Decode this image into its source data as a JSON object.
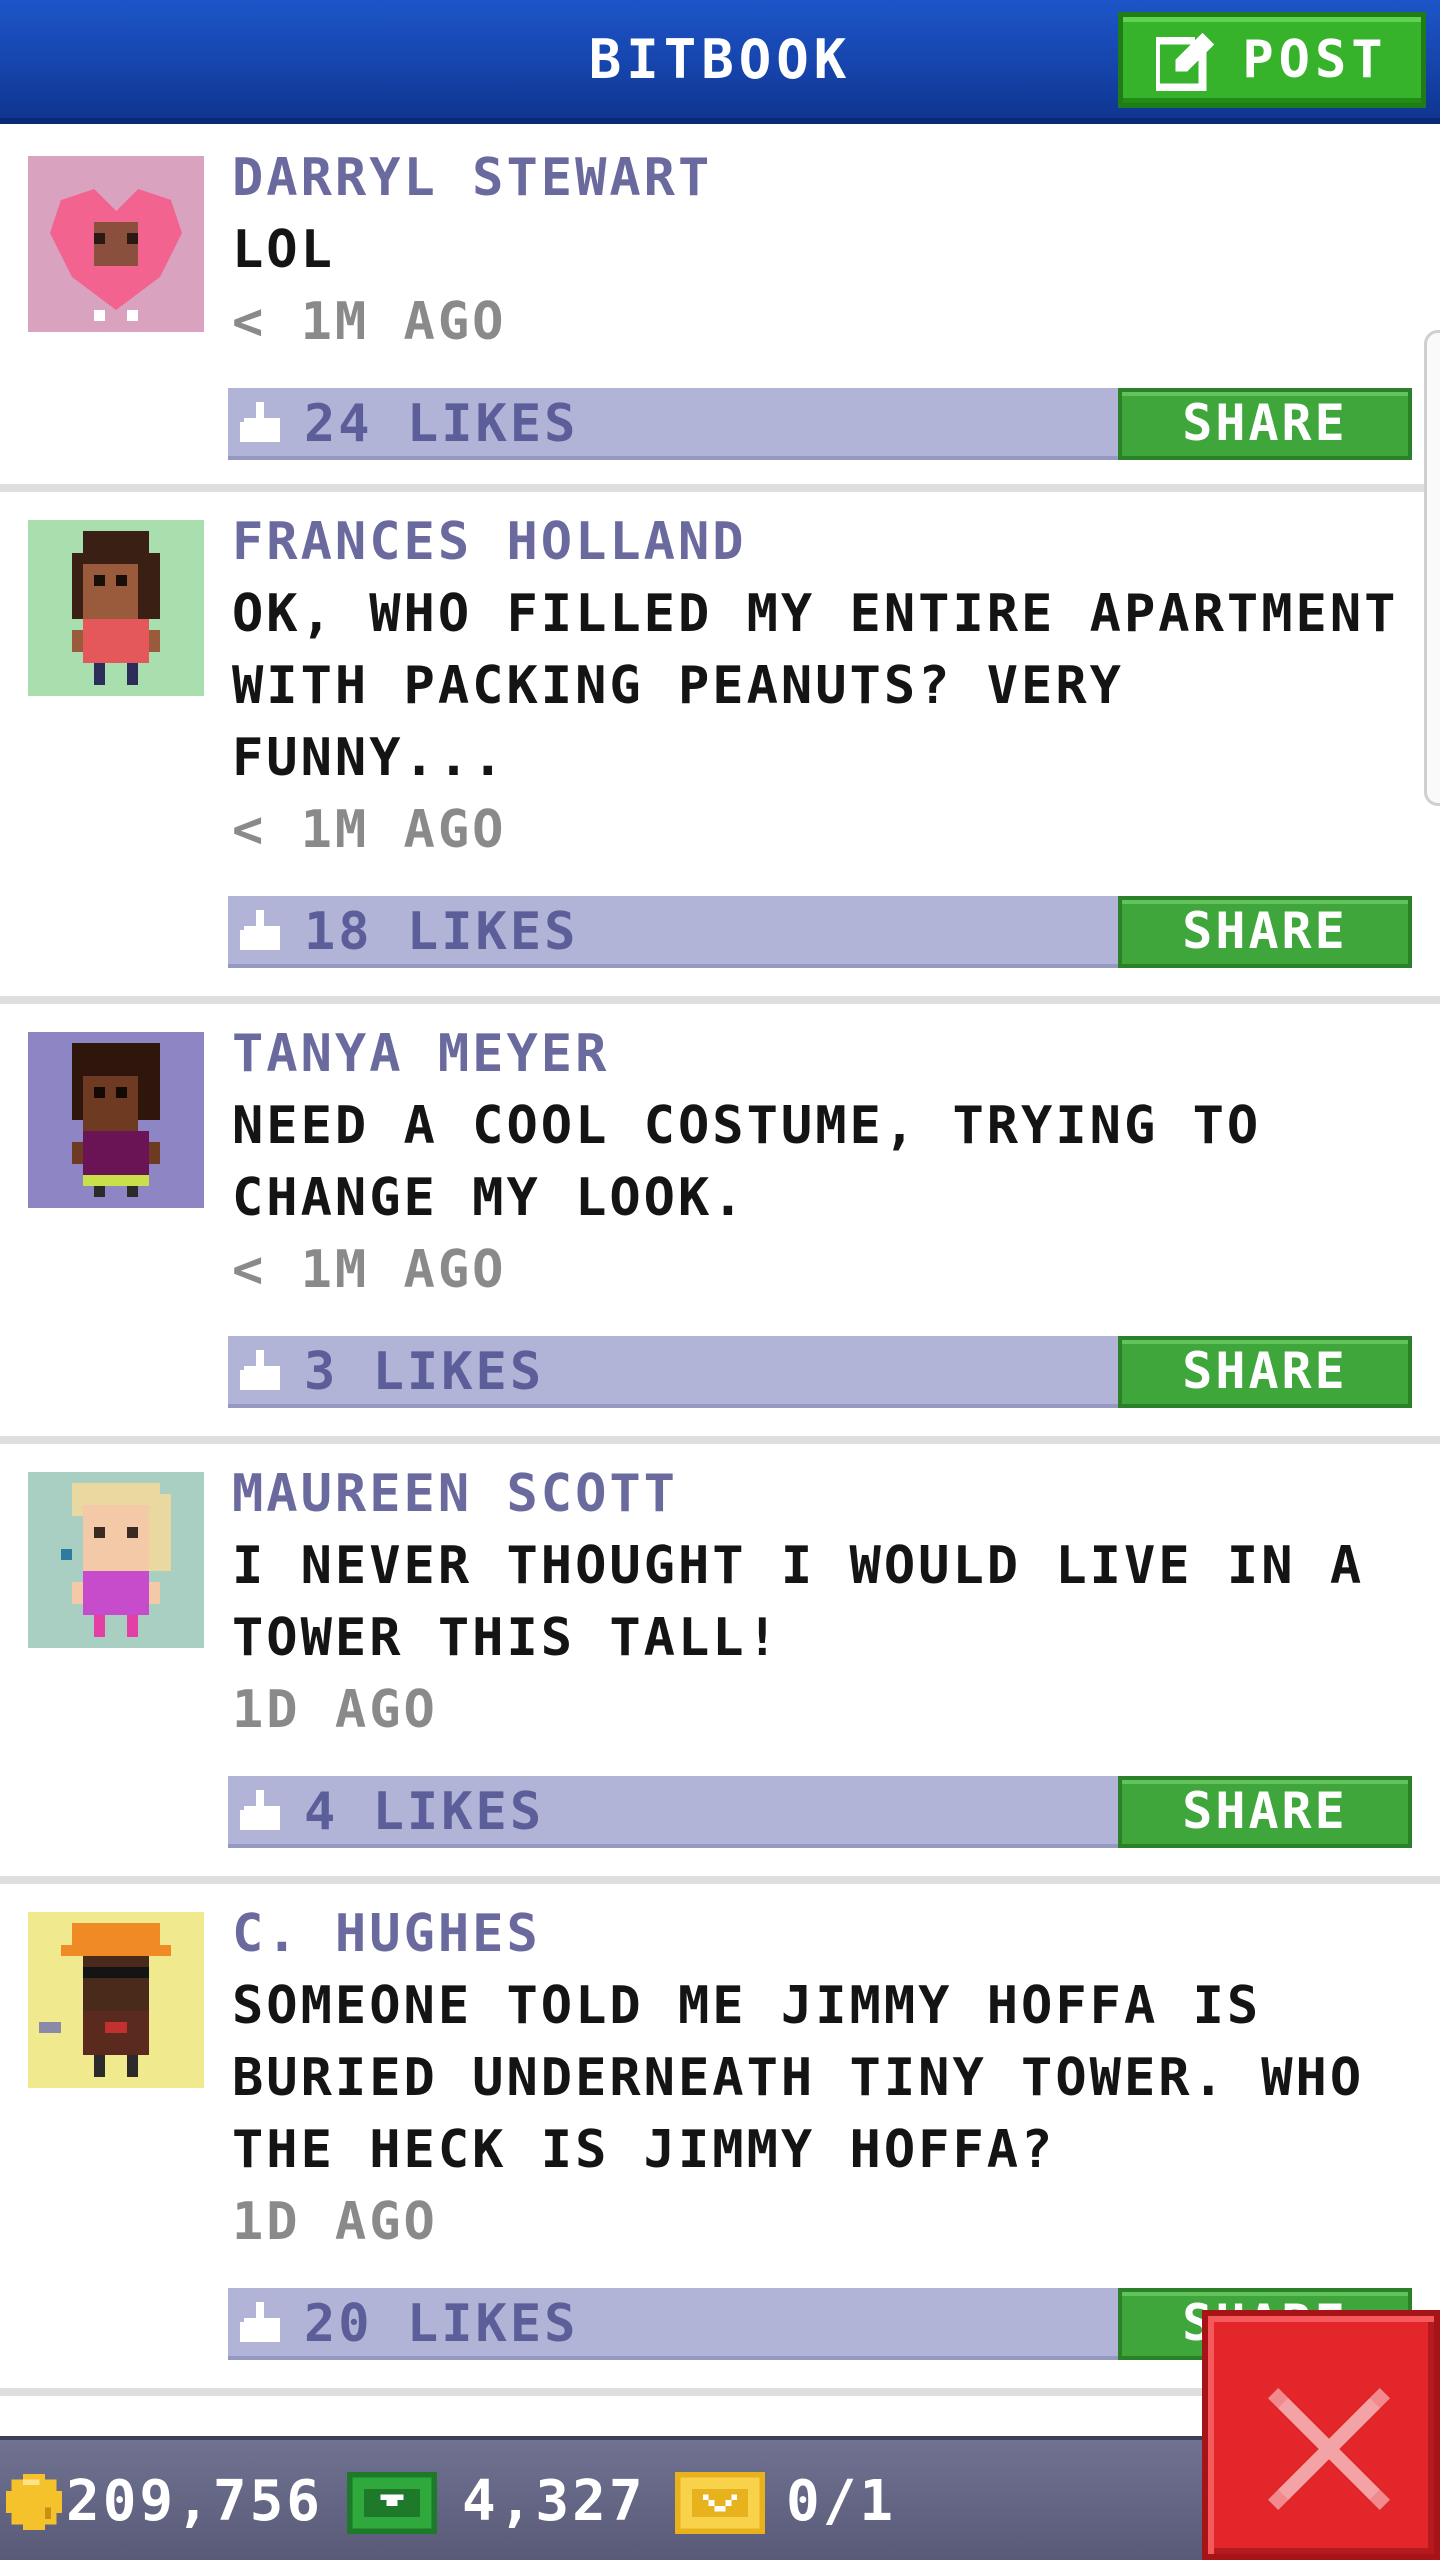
{
  "header": {
    "title": "BITBOOK",
    "post_label": "POST"
  },
  "posts": [
    {
      "name": "DARRYL STEWART",
      "text": "LOL",
      "time": "< 1M AGO",
      "likes": "24 LIKES",
      "share_label": "SHARE",
      "avatar_bg": "#d9a3c0"
    },
    {
      "name": "FRANCES HOLLAND",
      "text": "OK, WHO FILLED MY ENTIRE APARTMENT WITH PACKING PEANUTS? VERY FUNNY...",
      "time": "< 1M AGO",
      "likes": "18 LIKES",
      "share_label": "SHARE",
      "avatar_bg": "#a9dfae"
    },
    {
      "name": "TANYA MEYER",
      "text": "NEED A COOL COSTUME, TRYING TO CHANGE MY LOOK.",
      "time": "< 1M AGO",
      "likes": "3 LIKES",
      "share_label": "SHARE",
      "avatar_bg": "#8e85c4"
    },
    {
      "name": "MAUREEN SCOTT",
      "text": "I NEVER THOUGHT I WOULD LIVE IN A TOWER THIS TALL!",
      "time": "1D AGO",
      "likes": "4 LIKES",
      "share_label": "SHARE",
      "avatar_bg": "#a9cfc3"
    },
    {
      "name": "C. HUGHES",
      "text": "SOMEONE TOLD ME JIMMY HOFFA IS BURIED UNDERNEATH TINY TOWER. WHO THE HECK IS JIMMY HOFFA?",
      "time": "1D AGO",
      "likes": "20 LIKES",
      "share_label": "SHARE",
      "avatar_bg": "#f1e98e"
    }
  ],
  "status": {
    "coins": "209,756",
    "bux": "4,327",
    "tickets": "0/1"
  },
  "icons": {
    "post": "edit-icon",
    "like": "thumbs-up-icon",
    "coin": "coin-icon",
    "bux": "bux-icon",
    "ticket": "ticket-icon",
    "close": "close-icon"
  },
  "colors": {
    "header": "#1543aa",
    "accent_green": "#3fa63b",
    "likes_bar": "#b1b4d6",
    "close_red": "#e3262a"
  }
}
